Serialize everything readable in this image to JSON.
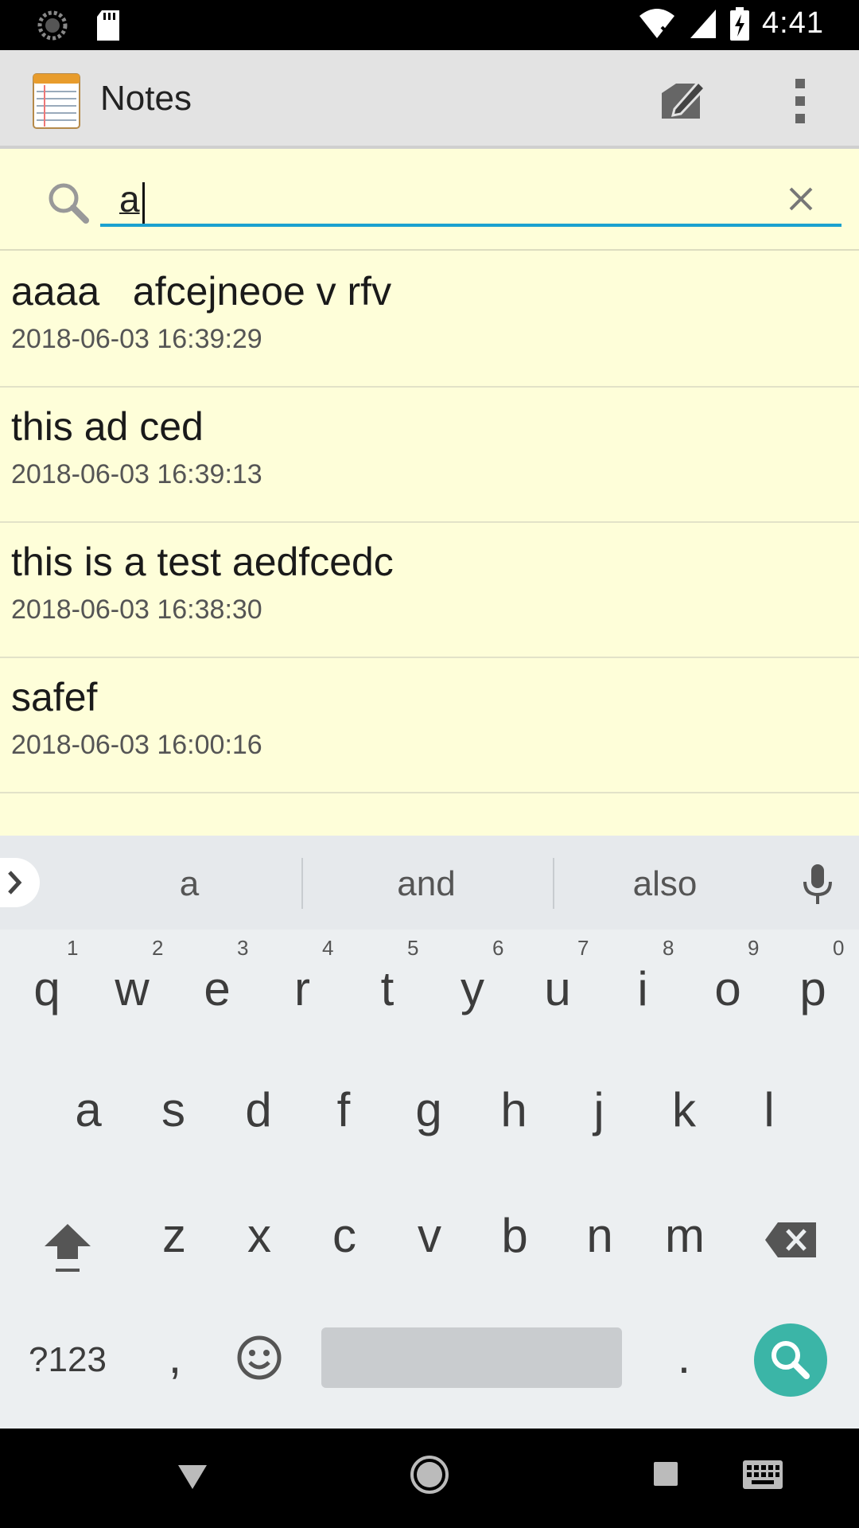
{
  "status_bar": {
    "time": "4:41",
    "icons": [
      "sync-icon",
      "sd-card-icon",
      "wifi-off-icon",
      "signal-icon",
      "battery-charging-icon"
    ]
  },
  "action_bar": {
    "title": "Notes",
    "icons": [
      "notepad-app-icon",
      "new-note-icon",
      "overflow-menu-icon"
    ]
  },
  "search": {
    "query": "a",
    "icons": [
      "search-icon",
      "clear-icon"
    ]
  },
  "notes": [
    {
      "title": "aaaa   afcejneoe v rfv",
      "date": "2018-06-03 16:39:29"
    },
    {
      "title": "this ad ced",
      "date": "2018-06-03 16:39:13"
    },
    {
      "title": "this is a test aedfcedc",
      "date": "2018-06-03 16:38:30"
    },
    {
      "title": "safef",
      "date": "2018-06-03 16:00:16"
    }
  ],
  "keyboard": {
    "suggestions": [
      "a",
      "and",
      "also"
    ],
    "row1": [
      "q",
      "w",
      "e",
      "r",
      "t",
      "y",
      "u",
      "i",
      "o",
      "p"
    ],
    "row1_hints": [
      "1",
      "2",
      "3",
      "4",
      "5",
      "6",
      "7",
      "8",
      "9",
      "0"
    ],
    "row2": [
      "a",
      "s",
      "d",
      "f",
      "g",
      "h",
      "j",
      "k",
      "l"
    ],
    "row3": [
      "z",
      "x",
      "c",
      "v",
      "b",
      "n",
      "m"
    ],
    "symbols_label": "?123",
    "comma_label": ",",
    "period_label": ".",
    "accent_color": "#3bb5a7"
  },
  "nav_bar": {
    "icons": [
      "back-icon",
      "home-icon",
      "recents-icon",
      "keyboard-switch-icon"
    ]
  }
}
